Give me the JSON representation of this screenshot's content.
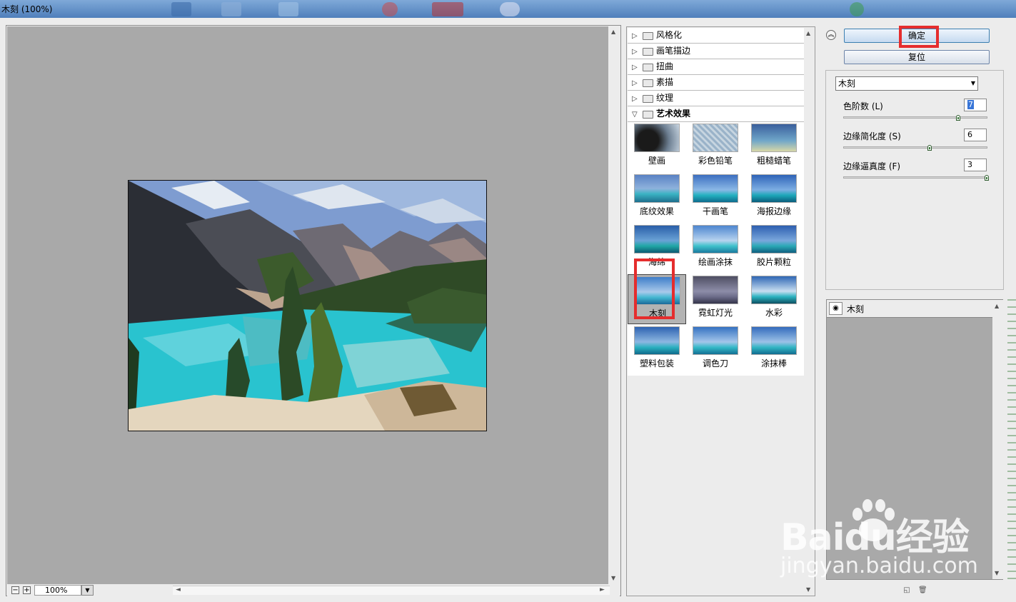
{
  "window": {
    "title": "木刻 (100%)"
  },
  "preview": {
    "zoom": "100%"
  },
  "gallery": {
    "folders": [
      {
        "label": "风格化",
        "open": false
      },
      {
        "label": "画笔描边",
        "open": false
      },
      {
        "label": "扭曲",
        "open": false
      },
      {
        "label": "素描",
        "open": false
      },
      {
        "label": "纹理",
        "open": false
      },
      {
        "label": "艺术效果",
        "open": true
      }
    ],
    "filters": [
      "壁画",
      "彩色铅笔",
      "粗糙蜡笔",
      "底纹效果",
      "干画笔",
      "海报边缘",
      "海绵",
      "绘画涂抹",
      "胶片颗粒",
      "木刻",
      "霓虹灯光",
      "水彩",
      "塑料包装",
      "调色刀",
      "涂抹棒"
    ],
    "selected": "木刻"
  },
  "buttons": {
    "ok": "确定",
    "reset": "复位"
  },
  "settings": {
    "filter_select": "木刻",
    "params": [
      {
        "label": "色阶数 (L)",
        "value": "7",
        "level": 0.8
      },
      {
        "label": "边缘简化度 (S)",
        "value": "6",
        "level": 0.6
      },
      {
        "label": "边缘逼真度 (F)",
        "value": "3",
        "level": 1.0
      }
    ]
  },
  "layers": {
    "items": [
      {
        "name": "木刻"
      }
    ]
  },
  "watermark": {
    "brand": "Baidu经验",
    "url": "jingyan.baidu.com"
  },
  "colors": {
    "highlight": "#e52d2d",
    "canvas_gray": "#a9a9a9",
    "lake": "#2ec3cf",
    "sky": "#7f9fcf"
  }
}
